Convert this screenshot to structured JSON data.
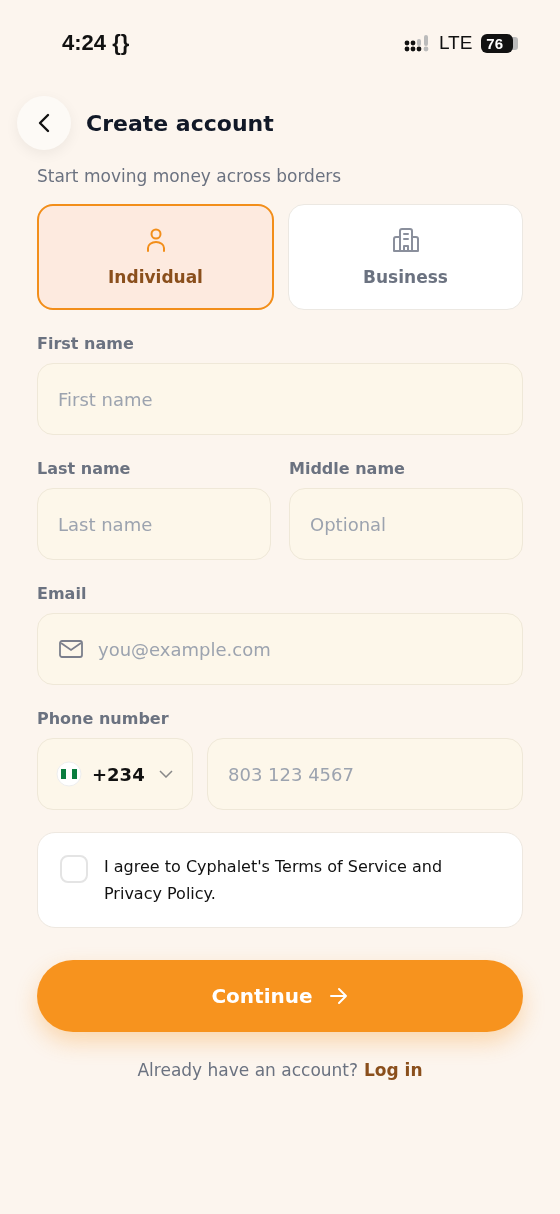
{
  "status_bar": {
    "time": "4:24 {}",
    "network": "LTE",
    "battery": "76"
  },
  "header": {
    "title": "Create account",
    "subtitle": "Start moving money across borders"
  },
  "account_types": [
    {
      "kind": "person",
      "label": "Individual",
      "selected": true
    },
    {
      "kind": "building",
      "label": "Business",
      "selected": false
    }
  ],
  "first_name": {
    "label": "First name",
    "placeholder": "First name"
  },
  "last_name": {
    "label": "Last name",
    "placeholder": "Last name"
  },
  "middle_name": {
    "label": "Middle name",
    "placeholder": "Optional"
  },
  "email": {
    "label": "Email",
    "placeholder": "you@example.com"
  },
  "phone": {
    "label": "Phone number",
    "country_code": "+234",
    "placeholder": "803 123 4567"
  },
  "terms": {
    "text": "I agree to Cyphalet's Terms of Service and Privacy Policy.",
    "checked": false
  },
  "continue_button": {
    "label": "Continue"
  },
  "login_prompt": {
    "text": "Already have an account?",
    "link": "Log in"
  }
}
